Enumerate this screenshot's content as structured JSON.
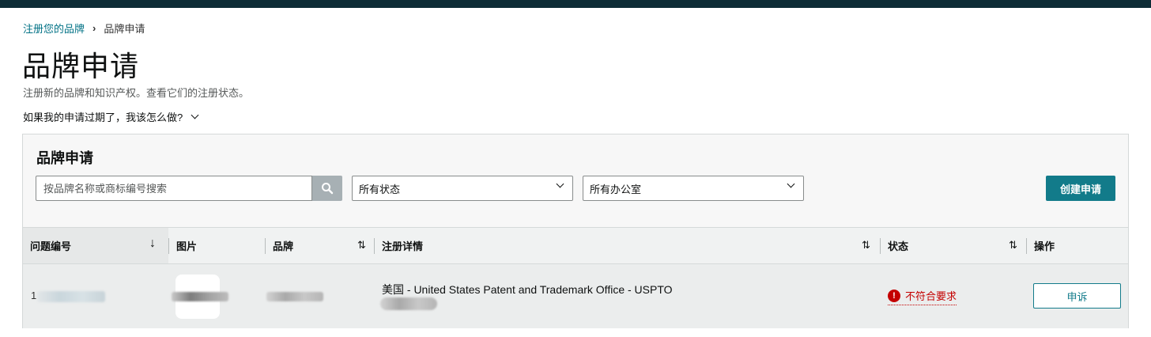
{
  "breadcrumb": {
    "root": "注册您的品牌",
    "separator": "›",
    "current": "品牌申请"
  },
  "page": {
    "title": "品牌申请",
    "subtitle": "注册新的品牌和知识产权。查看它们的注册状态。",
    "faq": "如果我的申请过期了，我该怎么做?"
  },
  "panel": {
    "title": "品牌申请",
    "search_placeholder": "按品牌名称或商标编号搜索",
    "status_filter": "所有状态",
    "office_filter": "所有办公室",
    "create_button": "创建申请"
  },
  "table": {
    "columns": [
      "问题编号",
      "图片",
      "品牌",
      "注册详情",
      "状态",
      "操作"
    ],
    "sort_icons": {
      "case_id": "↓",
      "brand": "⇅",
      "details": "⇅",
      "status": "⇅"
    },
    "rows": [
      {
        "case_id_prefix": "1",
        "details": "美国 - United States Patent and Trademark Office - USPTO",
        "status": "不符合要求",
        "status_icon": "!",
        "action": "申诉"
      }
    ]
  },
  "colors": {
    "accent": "#127b8a",
    "link": "#007185",
    "error": "#c40000",
    "topbar": "#0d2c36"
  }
}
